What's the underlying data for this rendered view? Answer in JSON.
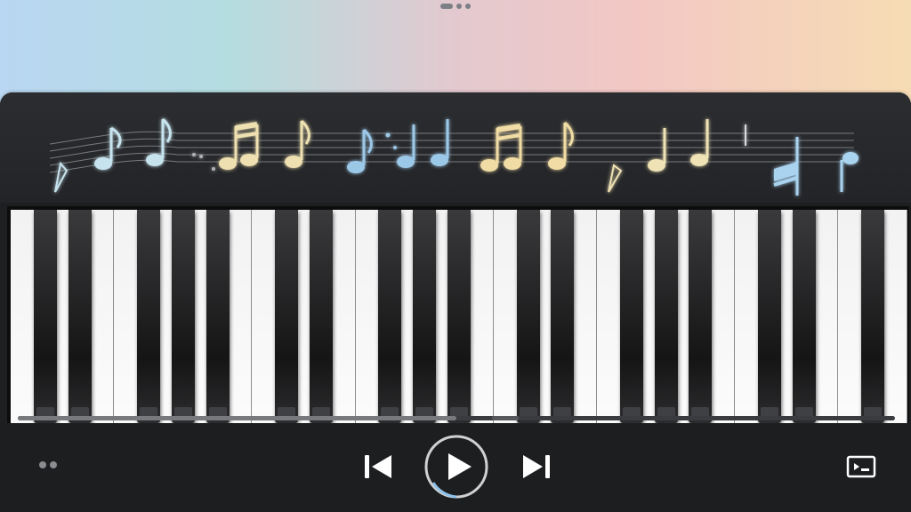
{
  "window": {
    "handle": "drag-handle"
  },
  "staff": {
    "groups": [
      {
        "color": "#c7e4ee"
      },
      {
        "color": "#eee0b0"
      },
      {
        "color": "#9cc8e8"
      },
      {
        "color": "#f0dca4"
      },
      {
        "color": "#efe2b4"
      },
      {
        "color": "#a9d3ef"
      }
    ]
  },
  "keyboard": {
    "white_keys": 26,
    "black_key_color": "#151516"
  },
  "scrollbar": {
    "position": 0.5
  },
  "controls": {
    "icons": {
      "more": "dots-icon",
      "previous": "skip-previous-icon",
      "play": "play-icon",
      "next": "skip-next-icon",
      "output": "screen-output-icon"
    },
    "accent": "#ffffff"
  }
}
